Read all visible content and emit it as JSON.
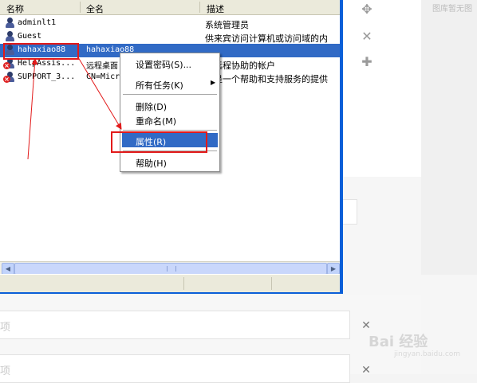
{
  "window": {
    "columns": [
      "名称",
      "全名",
      "描述"
    ],
    "rows": [
      {
        "name": "adminlt1",
        "full_name": "",
        "description": "系统管理员",
        "disabled": false,
        "selected": false
      },
      {
        "name": "Guest",
        "full_name": "",
        "description": "供来宾访问计算机或访问域的内",
        "disabled": false,
        "selected": false
      },
      {
        "name": "hahaxiao88",
        "full_name": "hahaxiao88",
        "description": "",
        "disabled": false,
        "selected": true
      },
      {
        "name": "HelpAssis...",
        "full_name": "远程桌面",
        "description": "供远程协助的帐户",
        "disabled": true,
        "selected": false
      },
      {
        "name": "SUPPORT_3...",
        "full_name": "CN=Micr",
        "description": "这是一个帮助和支持服务的提供",
        "disabled": true,
        "selected": false
      }
    ]
  },
  "context_menu": {
    "items": [
      "设置密码(S)...",
      "所有任务(K)",
      "删除(D)",
      "重命名(M)",
      "属性(R)",
      "帮助(H)"
    ],
    "active": "属性(R)"
  },
  "right_panel": {
    "label": "图库暂无图",
    "icons": [
      "move-icon",
      "close-icon",
      "plus-icon"
    ]
  },
  "lower_fields": [
    {
      "placeholder": "项"
    },
    {
      "placeholder": "项"
    }
  ],
  "watermark": {
    "text": "Bai 经验",
    "url": "jingyan.baidu.com"
  },
  "colors": {
    "selection": "#316ac5",
    "annotation": "#e21a1a",
    "window_border": "#0a5fd8"
  }
}
